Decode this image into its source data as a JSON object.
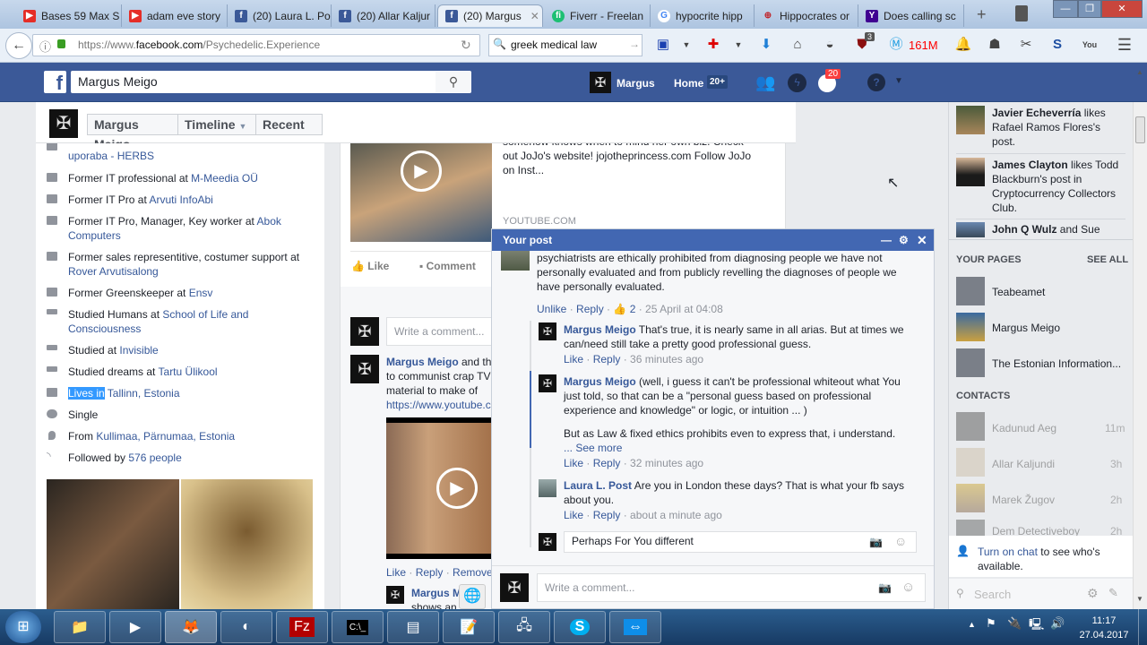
{
  "browser": {
    "tabs": [
      {
        "label": "Bases 59 Max S",
        "icon": "youtube-icon",
        "color": "#e52d27"
      },
      {
        "label": "adam eve story",
        "icon": "youtube-icon",
        "color": "#e52d27"
      },
      {
        "label": "(20) Laura L. Po",
        "icon": "facebook-icon",
        "color": "#3b5998"
      },
      {
        "label": "(20) Allar Kaljur",
        "icon": "facebook-icon",
        "color": "#3b5998"
      },
      {
        "label": "(20) Margus",
        "icon": "facebook-icon",
        "color": "#3b5998",
        "active": true
      },
      {
        "label": "Fiverr - Freelan",
        "icon": "fiverr-icon",
        "color": "#1dbf73"
      },
      {
        "label": "hypocrite hipp",
        "icon": "google-icon",
        "color": "#4285f4"
      },
      {
        "label": "Hippocrates or",
        "icon": "target-icon",
        "color": "#c0272d"
      },
      {
        "label": "Does calling sc",
        "icon": "yahoo-icon",
        "color": "#400191"
      }
    ],
    "url_prefix": "https://www.",
    "url_domain": "facebook.com",
    "url_path": "/Psychedelic.Experience",
    "search_value": "greek medical law",
    "memory_badge": "161M",
    "ublock_count": "3"
  },
  "fb": {
    "search_value": "Margus Meigo",
    "user_name": "Margus",
    "home_label": "Home",
    "home_badge": "20+",
    "notif_count": "20",
    "profile_name": "Margus Meigo",
    "timeline_label": "Timeline",
    "recent_label": "Recent"
  },
  "intro": [
    {
      "text": "",
      "link": "uporaba - HERBS",
      "icon": "briefcase-icon"
    },
    {
      "text": "Former IT professional at ",
      "link": "M-Meedia OÜ",
      "icon": "briefcase-icon"
    },
    {
      "text": "Former IT Pro at ",
      "link": "Arvuti InfoAbi",
      "icon": "briefcase-icon"
    },
    {
      "text": "Former IT Pro, Manager, Key worker at ",
      "link": "Abok Computers",
      "icon": "briefcase-icon"
    },
    {
      "text": "Former sales representitive, costumer support at ",
      "link": "Rover Arvutisalong",
      "icon": "briefcase-icon"
    },
    {
      "text": "Former Greenskeeper at ",
      "link": "Ensv",
      "icon": "briefcase-icon"
    },
    {
      "text": "Studied Humans at ",
      "link": "School of Life and Consciousness",
      "icon": "graduation-cap-icon"
    },
    {
      "text": "Studied at ",
      "link": "Invisible",
      "icon": "graduation-cap-icon"
    },
    {
      "text": "Studied dreams at ",
      "link": "Tartu Ülikool",
      "icon": "graduation-cap-icon"
    },
    {
      "text": "Lives in",
      "link": " Tallinn, Estonia",
      "icon": "home-icon"
    },
    {
      "text": "Single",
      "link": "",
      "icon": "heart-icon"
    },
    {
      "text": "From ",
      "link": "Kullimaa, Pärnumaa, Estonia",
      "icon": "location-pin-icon"
    },
    {
      "text": "Followed by ",
      "link": "576 people",
      "icon": "rss-icon"
    }
  ],
  "post": {
    "description": "somehow knows when to mind her own biz. Check out JoJo's website! jojotheprincess.com Follow JoJo on Inst...",
    "source": "YOUTUBE.COM",
    "like": "Like",
    "comment": "Comment",
    "write_placeholder": "Write a comment...",
    "comment_author": "Margus Meigo",
    "comment_text": " and th to communist crap TV material to make of TV",
    "comment_link": "https://www.youtube.c",
    "actions": [
      "Like",
      "Reply",
      "Remove"
    ],
    "reply_author": "Margus M",
    "reply_text": "shows an"
  },
  "chat": {
    "title": "Your post",
    "comments": [
      {
        "author": "",
        "text": "psychiatrists are ethically prohibited from diagnosing people we have not personally evaluated and from publicly revelling the diagnoses of people we have personally evaluated.",
        "actions": [
          "Unlike",
          "Reply"
        ],
        "likes": "2",
        "time": "25 April at 04:08"
      },
      {
        "author": "Margus Meigo",
        "text": "That's true, it is nearly same in all arias. But at times we can/need still take a pretty good professional guess.",
        "actions": [
          "Like",
          "Reply"
        ],
        "time": "36 minutes ago"
      },
      {
        "author": "Margus Meigo",
        "text": "(well, i guess it can't be professional whiteout what You just told, so that can be a \"personal guess based on professional experience and knowledge\" or logic, or intuition ... )",
        "text2": "But as Law & fixed ethics prohibits even to express that, i understand.",
        "see_more": "... See more",
        "actions": [
          "Like",
          "Reply"
        ],
        "time": "32 minutes ago"
      },
      {
        "author": "Laura L. Post",
        "text": "Are you in London these days? That is what your fb says about you.",
        "actions": [
          "Like",
          "Reply"
        ],
        "time": "about a minute ago"
      }
    ],
    "reply_value": "Perhaps For You different",
    "comment_placeholder": "Write a comment..."
  },
  "ticker": [
    {
      "name": "Javier Echeverría",
      "text": " likes Rafael Ramos Flores's post."
    },
    {
      "name": "James Clayton",
      "text": " likes Todd Blackburn's post in Cryptocurrency Collectors Club."
    },
    {
      "name": "John Q Wulz",
      "text": " and Sue"
    }
  ],
  "pages": {
    "heading": "YOUR PAGES",
    "see_all": "SEE ALL",
    "items": [
      "Teabeamet",
      "Margus Meigo",
      "The Estonian Information..."
    ]
  },
  "contacts": {
    "heading": "CONTACTS",
    "items": [
      {
        "name": "Kadunud Aeg",
        "time": "11m"
      },
      {
        "name": "Allar Kaljundi",
        "time": "3h"
      },
      {
        "name": "Marek Žugov",
        "time": "2h"
      },
      {
        "name": "Dem Detectiveboy",
        "time": "2h"
      }
    ],
    "turn_on_link": "Turn on chat",
    "turn_on_text": " to see who's available.",
    "search_placeholder": "Search"
  },
  "taskbar": {
    "time": "11:17",
    "date": "27.04.2017",
    "apps": [
      "explorer",
      "media-player",
      "firefox",
      "seamonkey",
      "filezilla",
      "cmd",
      "notepad",
      "notepad-plus",
      "network",
      "skype",
      "teamviewer"
    ]
  }
}
